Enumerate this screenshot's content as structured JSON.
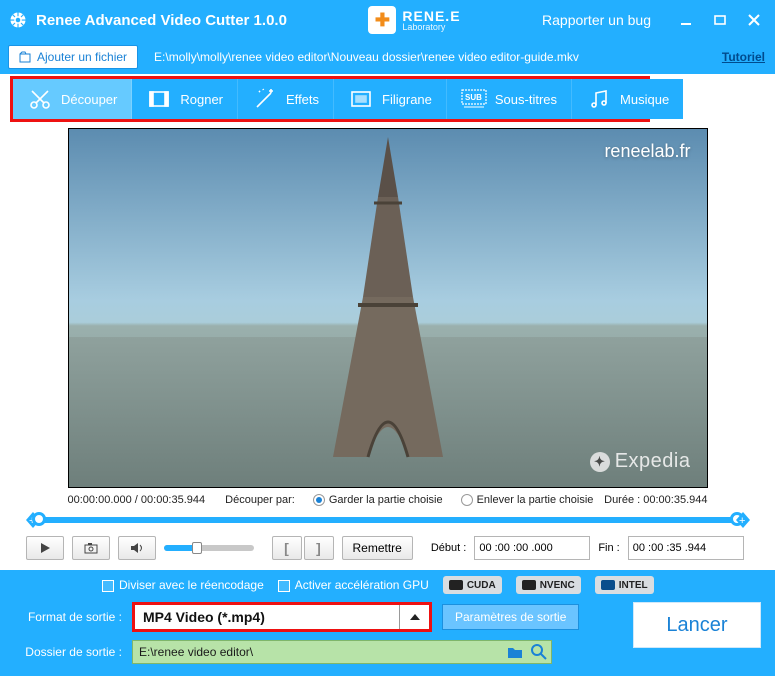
{
  "titlebar": {
    "title": "Renee Advanced Video Cutter 1.0.0",
    "brand_l1": "RENE.E",
    "brand_l2": "Laboratory",
    "bug": "Rapporter un bug"
  },
  "toolbar": {
    "add_file": "Ajouter un fichier",
    "filepath": "E:\\molly\\molly\\renee video editor\\Nouveau dossier\\renee video editor-guide.mkv",
    "tutorial": "Tutoriel"
  },
  "tabs": [
    {
      "id": "cut",
      "label": "Découper",
      "selected": true
    },
    {
      "id": "crop",
      "label": "Rogner",
      "selected": false
    },
    {
      "id": "fx",
      "label": "Effets",
      "selected": false
    },
    {
      "id": "wm",
      "label": "Filigrane",
      "selected": false
    },
    {
      "id": "sub",
      "label": "Sous-titres",
      "selected": false
    },
    {
      "id": "music",
      "label": "Musique",
      "selected": false
    }
  ],
  "preview": {
    "watermark": "reneelab.fr",
    "expedia": "Expedia"
  },
  "playback": {
    "current": "00:00:00.000",
    "total": "00:00:35.944",
    "cut_by_label": "Découper par:",
    "keep_label": "Garder la partie choisie",
    "remove_label": "Enlever la partie choisie",
    "keep_selected": true,
    "duration_label": "Durée :",
    "duration_value": "00:00:35.944",
    "reset": "Remettre",
    "start_label": "Début :",
    "start_value": "00 :00 :00 .000",
    "end_label": "Fin :",
    "end_value": "00 :00 :35 .944"
  },
  "options": {
    "split_reencode": "Diviser avec le réencodage",
    "gpu_accel": "Activer accélération GPU",
    "cuda": "CUDA",
    "nvenc": "NVENC",
    "intel": "INTEL"
  },
  "output": {
    "format_label": "Format de sortie :",
    "format_value": "MP4 Video (*.mp4)",
    "params": "Paramètres de sortie",
    "folder_label": "Dossier de sortie :",
    "folder_value": "E:\\renee video editor\\",
    "launch": "Lancer"
  }
}
